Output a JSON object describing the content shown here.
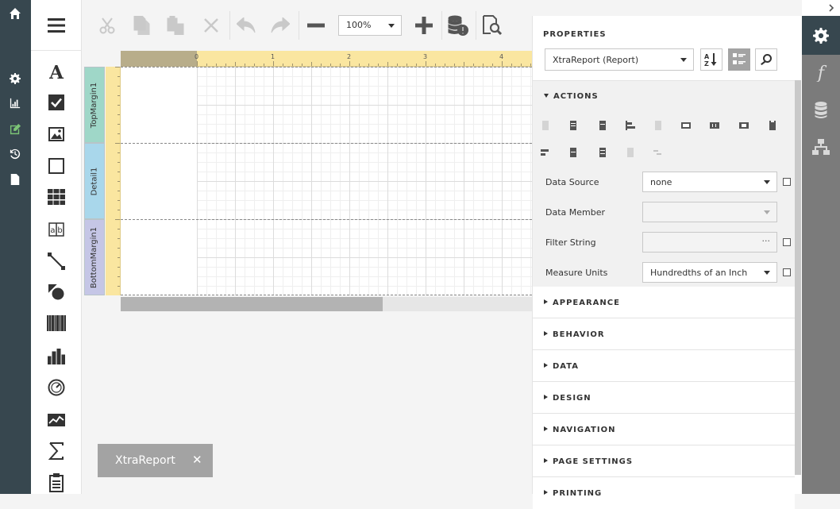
{
  "nav": {
    "items": [
      {
        "name": "home-icon"
      },
      {
        "name": "settings-icon"
      },
      {
        "name": "chart-icon"
      },
      {
        "name": "edit-icon",
        "active": true
      },
      {
        "name": "history-icon"
      },
      {
        "name": "document-icon"
      }
    ]
  },
  "toolbox": {
    "items": [
      "label-tool",
      "checkbox-tool",
      "picture-tool",
      "panel-tool",
      "table-tool",
      "character-comb-tool",
      "line-tool",
      "shape-tool",
      "barcode-tool",
      "chart-tool",
      "gauge-tool",
      "sparkline-tool",
      "summary-tool",
      "page-info-tool"
    ]
  },
  "toolbar": {
    "zoom": "100%"
  },
  "design": {
    "ruler_numbers": [
      "0",
      "1",
      "2",
      "3",
      "4"
    ],
    "bands": [
      "TopMargin1",
      "Detail1",
      "BottomMargin1"
    ],
    "band_colors": [
      "#9fd7c8",
      "#a9d7eb",
      "#c5c6e6"
    ],
    "report_tab": "XtraReport",
    "report_tab_close": "✕"
  },
  "properties": {
    "title": "PROPERTIES",
    "object_selector": "XtraReport (Report)",
    "actions_header": "ACTIONS",
    "fields": [
      {
        "label": "Data Source",
        "value": "none",
        "dropdown": true,
        "checkbox": true
      },
      {
        "label": "Data Member",
        "value": "",
        "dropdown": true,
        "disabled": true,
        "checkbox": false
      },
      {
        "label": "Filter String",
        "value": "",
        "ellipsis": "···",
        "disabled": true,
        "checkbox": true
      },
      {
        "label": "Measure Units",
        "value": "Hundredths of an Inch",
        "dropdown": true,
        "checkbox": true
      }
    ],
    "sections": [
      "APPEARANCE",
      "BEHAVIOR",
      "DATA",
      "DESIGN",
      "NAVIGATION",
      "PAGE SETTINGS",
      "PRINTING"
    ]
  },
  "right_tabs": [
    "properties-tab",
    "expressions-tab",
    "field-list-tab",
    "report-explorer-tab"
  ],
  "accent": "#37474f"
}
